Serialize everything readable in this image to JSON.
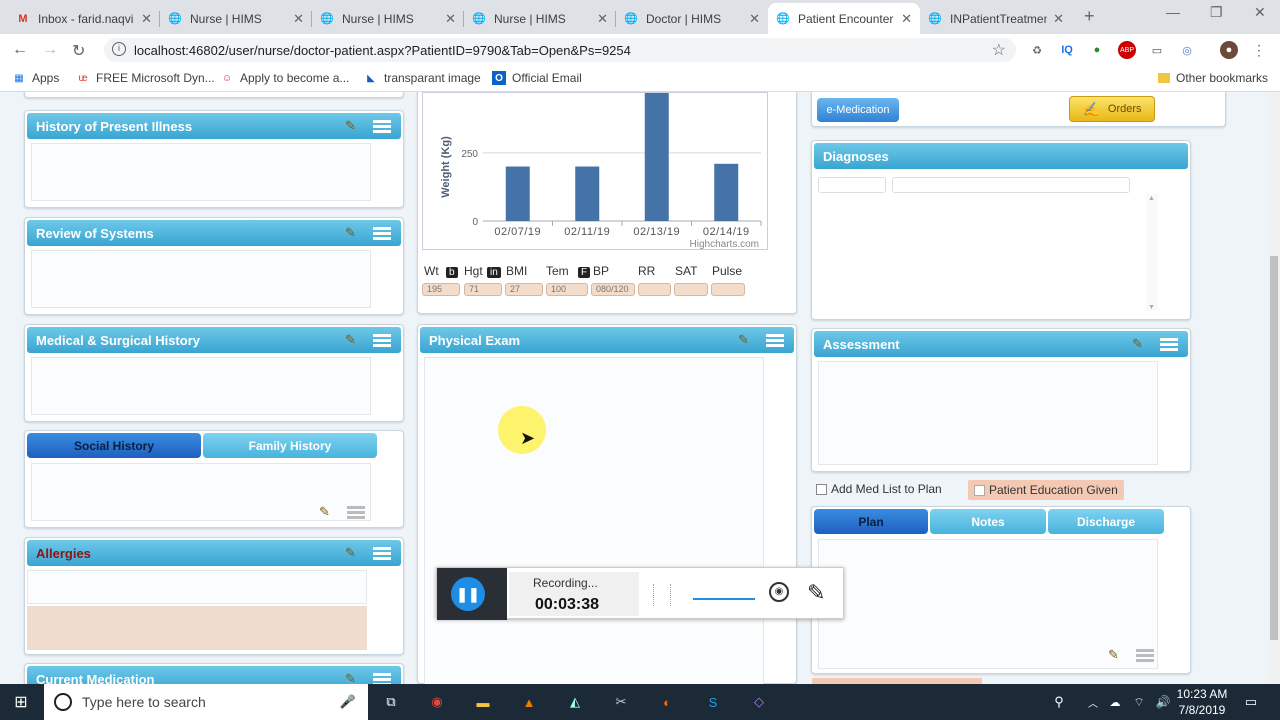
{
  "browser": {
    "tabs": [
      {
        "label": "Inbox - farid.naqvi",
        "icon": "gmail-icon"
      },
      {
        "label": "Nurse | HIMS",
        "icon": "globe-icon"
      },
      {
        "label": "Nurse | HIMS",
        "icon": "globe-icon"
      },
      {
        "label": "Nurse | HIMS",
        "icon": "globe-icon"
      },
      {
        "label": "Doctor | HIMS",
        "icon": "globe-icon"
      },
      {
        "label": "Patient Encounter",
        "icon": "globe-icon"
      },
      {
        "label": "INPatientTreatmen",
        "icon": "globe-icon"
      }
    ],
    "url": "localhost:46802/user/nurse/doctor-patient.aspx?PatientID=9790&Tab=Open&Ps=9254",
    "bookmarks": [
      {
        "label": "Apps"
      },
      {
        "label": "FREE Microsoft Dyn..."
      },
      {
        "label": "Apply to become a..."
      },
      {
        "label": "transparant image"
      },
      {
        "label": "Official Email"
      }
    ],
    "other_bookmarks": "Other bookmarks"
  },
  "left": {
    "hpi": "History of Present Illness",
    "ros": "Review of Systems",
    "msh": "Medical & Surgical History",
    "social_tab": "Social History",
    "family_tab": "Family History",
    "allergies": "Allergies",
    "current_med": "Current Medication"
  },
  "middle": {
    "physical_exam": "Physical Exam",
    "vitals": {
      "labels": [
        "Wt",
        "Hgt",
        "BMI",
        "Tem",
        "BP",
        "RR",
        "SAT",
        "Pulse"
      ],
      "units": {
        "wt": "b",
        "hgt": "in",
        "tem": "F"
      },
      "values": [
        "195",
        "71",
        "27",
        "100",
        "080/120",
        "",
        "",
        ""
      ]
    }
  },
  "chart_data": {
    "type": "bar",
    "categories": [
      "02/07/19",
      "02/11/19",
      "02/13/19",
      "02/14/19"
    ],
    "values": [
      200,
      200,
      470,
      210
    ],
    "ylabel": "Weight (Kg)",
    "yticks": [
      0,
      250
    ],
    "ylim": [
      0,
      470
    ],
    "credit": "Highcharts.com",
    "color": "#4572a7"
  },
  "right": {
    "emedication": "e-Medication",
    "orders": "Orders",
    "diagnoses": "Diagnoses",
    "assessment": "Assessment",
    "add_med_list": "Add Med List to Plan",
    "patient_education": "Patient Education Given",
    "plan_tab": "Plan",
    "notes_tab": "Notes",
    "discharge_tab": "Discharge"
  },
  "recorder": {
    "status": "Recording...",
    "time": "00:03:38"
  },
  "taskbar": {
    "search_placeholder": "Type here to search",
    "time": "10:23 AM",
    "date": "7/8/2019"
  }
}
